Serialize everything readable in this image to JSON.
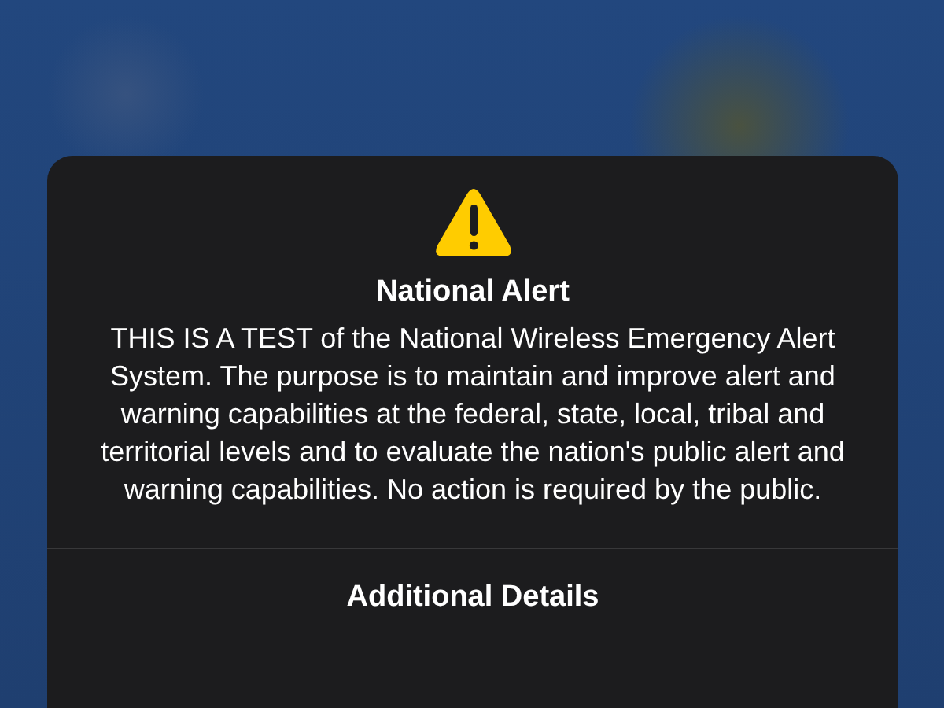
{
  "alert": {
    "title": "National Alert",
    "message": "THIS IS A TEST of the National Wireless Emergency Alert System. The purpose is to maintain and improve alert and warning capabilities at the federal, state, local, tribal and territorial levels and to evaluate the nation's public alert and warning capabilities. No action is required by the public.",
    "button": "Additional Details"
  }
}
